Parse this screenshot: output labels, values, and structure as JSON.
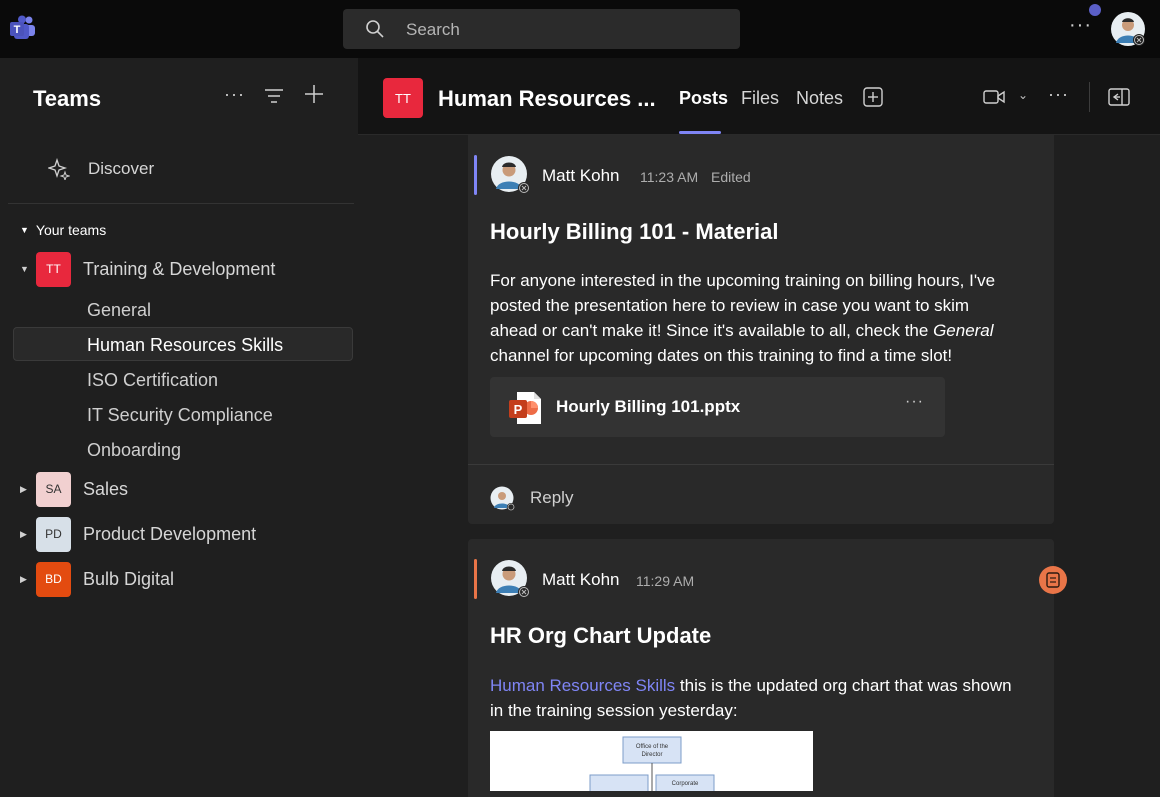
{
  "app": {
    "search_placeholder": "Search"
  },
  "sidebar": {
    "title": "Teams",
    "discover_label": "Discover",
    "your_teams_label": "Your teams",
    "teams": [
      {
        "initials": "TT",
        "name": "Training & Development",
        "color": "#e8283d",
        "text_color": "#ffffff"
      },
      {
        "initials": "SA",
        "name": "Sales",
        "color": "#f1d0d0",
        "text_color": "#333333"
      },
      {
        "initials": "PD",
        "name": "Product Development",
        "color": "#d7e0e8",
        "text_color": "#333333"
      },
      {
        "initials": "BD",
        "name": "Bulb Digital",
        "color": "#e34b10",
        "text_color": "#ffffff"
      }
    ],
    "channels": [
      "General",
      "Human Resources Skills",
      "ISO Certification",
      "IT Security Compliance",
      "Onboarding"
    ]
  },
  "channel_header": {
    "initials": "TT",
    "title": "Human Resources ...",
    "tabs": [
      "Posts",
      "Files",
      "Notes"
    ]
  },
  "posts": [
    {
      "author": "Matt Kohn",
      "time": "11:23 AM",
      "edited": "Edited",
      "subject": "Hourly Billing 101 - Material",
      "body_pre": "For anyone interested in the upcoming training on billing hours, I've posted the presentation here to review in case you want to skim ahead or can't make it! Since it's available to all, check the ",
      "body_em": "General",
      "body_post": " channel for upcoming dates on this training to find a time slot!",
      "attachment": "Hourly Billing 101.pptx",
      "reply_label": "Reply",
      "accent": "#7f85f5"
    },
    {
      "author": "Matt Kohn",
      "time": "11:29 AM",
      "subject": "HR Org Chart Update",
      "mention": "Human Resources Skills",
      "body": " this is the updated org chart that was shown in the training session yesterday:",
      "accent": "#e97548",
      "org_top": "Office of the Director",
      "org_right": "Corporate"
    }
  ],
  "icons": {
    "app_logo": "teams-logo-icon",
    "search": "search-icon",
    "filter": "filter-icon",
    "add": "plus-icon",
    "discover": "sparkle-icon",
    "video": "video-camera-icon",
    "panel": "open-panel-icon",
    "powerpoint": "powerpoint-file-icon",
    "note": "note-icon"
  }
}
